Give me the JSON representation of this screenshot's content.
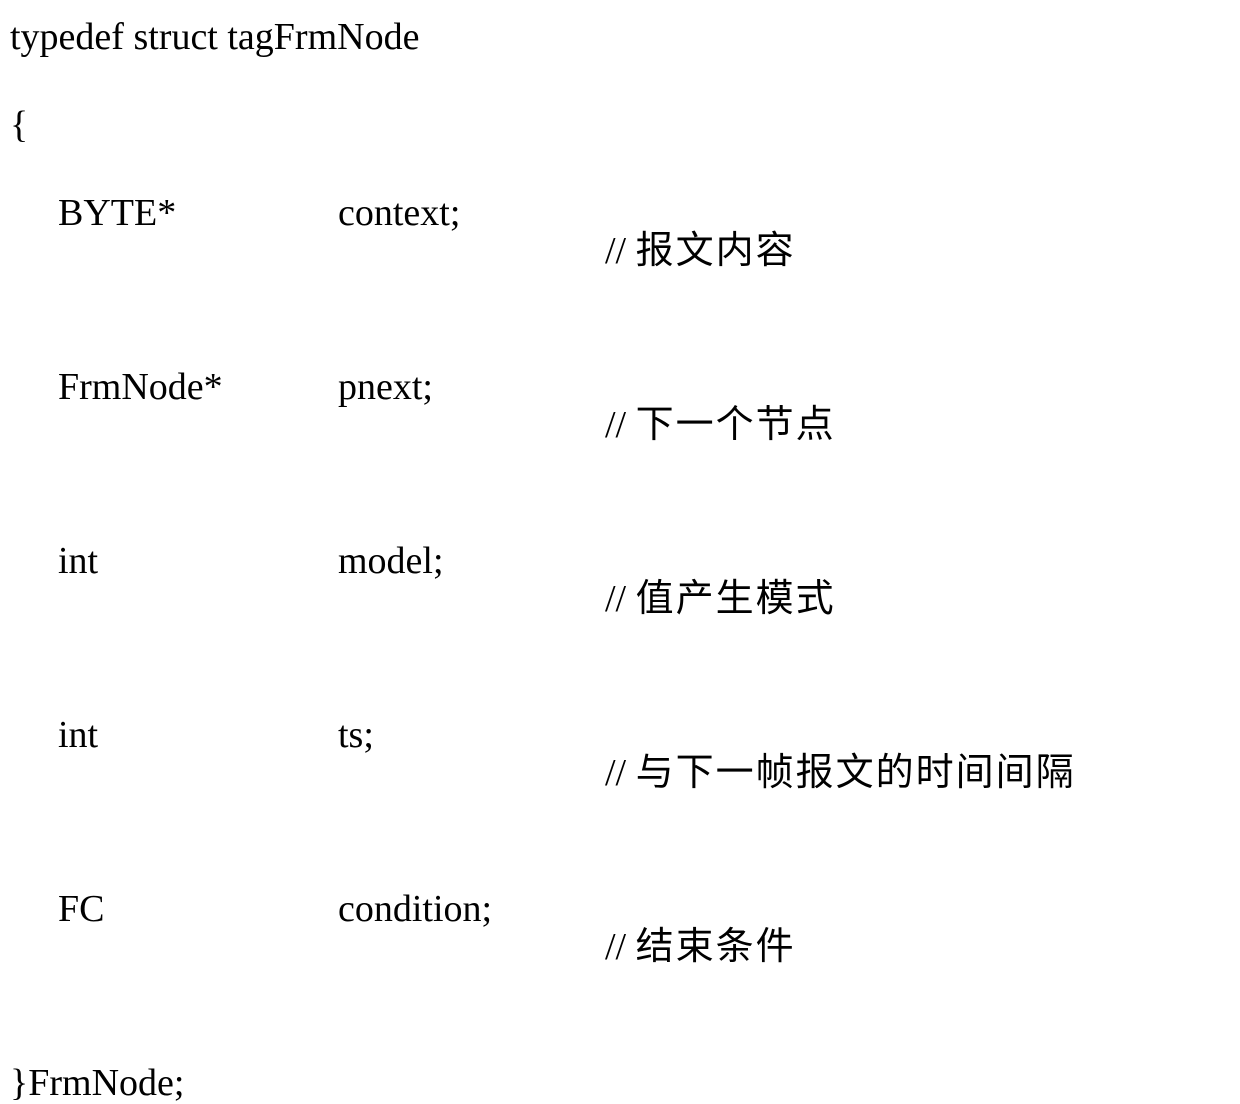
{
  "struct": {
    "decl": "typedef struct tagFrmNode",
    "open": "{",
    "close": "}FrmNode;",
    "members": [
      {
        "type": "BYTE*",
        "name": "context;",
        "comment_prefix": "// ",
        "comment_text": "报文内容"
      },
      {
        "type": "FrmNode*",
        "name": "pnext;",
        "comment_prefix": "// ",
        "comment_text": "下一个节点"
      },
      {
        "type": "int",
        "name": "model;",
        "comment_prefix": "// ",
        "comment_text": "值产生模式"
      },
      {
        "type": "int",
        "name": "ts;",
        "comment_prefix": "// ",
        "comment_text": "与下一帧报文的时间间隔"
      },
      {
        "type": "FC",
        "name": "condition;",
        "comment_prefix": "// ",
        "comment_text": "结束条件"
      }
    ]
  }
}
